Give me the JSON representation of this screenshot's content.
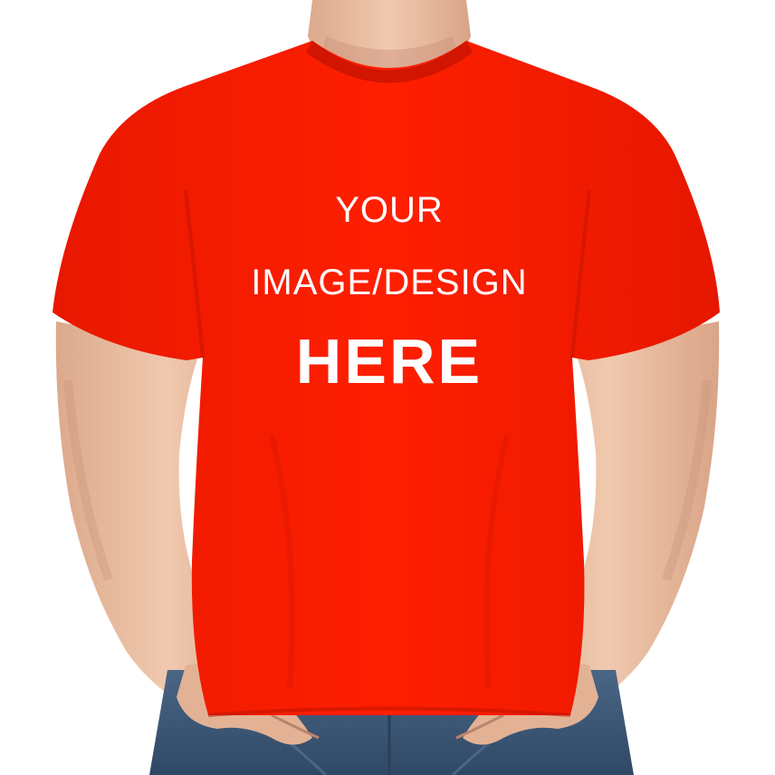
{
  "print": {
    "line1": "YOUR",
    "line2": "IMAGE/DESIGN",
    "line3": "HERE"
  },
  "colors": {
    "shirt": "#f21a00",
    "shirt_shadow": "#d31500",
    "skin": "#e9bfa3",
    "skin_shadow": "#cf9a7c",
    "jeans": "#3e5877",
    "text": "#ffffff",
    "background": "#ffffff"
  }
}
